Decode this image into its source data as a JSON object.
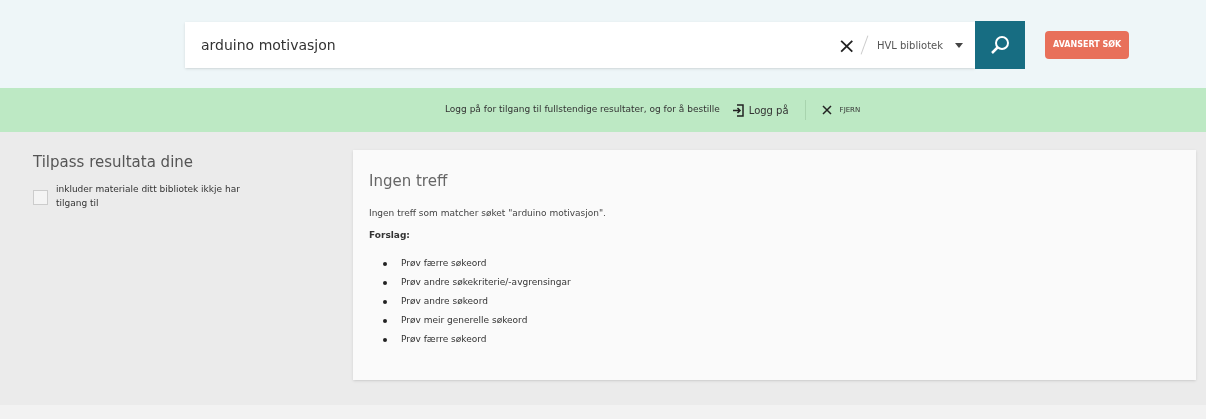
{
  "search": {
    "value": "arduino motivasjon",
    "clear": "×",
    "scope": "HVL bibliotek",
    "advanced": "AVANSERT SØK"
  },
  "banner": {
    "text": "Logg på for tilgang til fullstendige resultater, og for å bestille",
    "login": "Logg på",
    "dismiss": "FJERN"
  },
  "filters": {
    "title": "Tilpass resultata dine",
    "options": [
      {
        "label": "inkluder materiale ditt bibliotek ikkje har tilgang til",
        "checked": false
      }
    ]
  },
  "results": {
    "title": "Ingen treff",
    "message": "Ingen treff som matcher søket \"arduino motivasjon\".",
    "suggestions_title": "Forslag:",
    "suggestions": [
      "Prøv færre søkeord",
      "Prøv andre søkekriterie/-avgrensingar",
      "Prøv andre søkeord",
      "Prøv meir generelle søkeord",
      "Prøv færre søkeord"
    ]
  }
}
